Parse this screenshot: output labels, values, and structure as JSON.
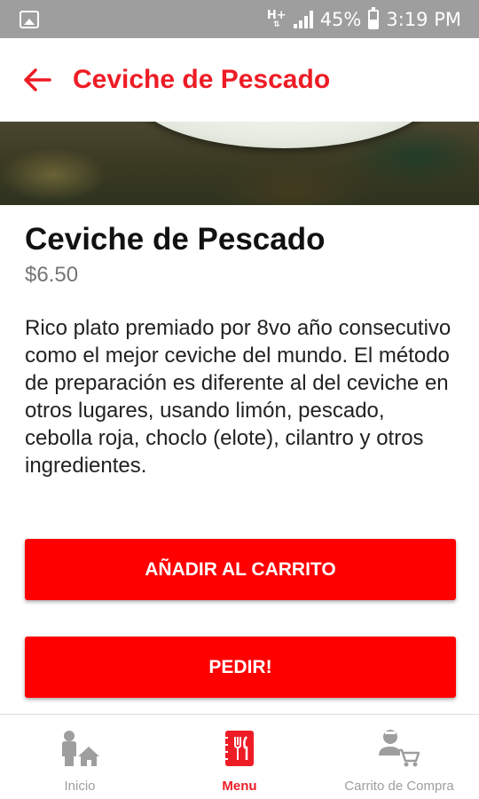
{
  "status_bar": {
    "network_type": "H+",
    "battery": "45%",
    "time": "3:19 PM"
  },
  "app_bar": {
    "title": "Ceviche de Pescado"
  },
  "product": {
    "name": "Ceviche de Pescado",
    "price": "$6.50",
    "description": "Rico plato premiado por 8vo año consecutivo como el mejor ceviche del mundo. El método de preparación es diferente al del ceviche en otros lugares, usando limón, pescado, cebolla roja, choclo (elote), cilantro y otros ingredientes."
  },
  "actions": {
    "add_to_cart": "AÑADIR AL CARRITO",
    "order": "PEDIR!"
  },
  "bottom_nav": {
    "items": [
      {
        "label": "Inicio",
        "icon": "home-person-icon",
        "active": false
      },
      {
        "label": "Menu",
        "icon": "menu-utensils-icon",
        "active": true
      },
      {
        "label": "Carrito de Compra",
        "icon": "person-cart-icon",
        "active": false
      }
    ]
  },
  "colors": {
    "accent": "#ee1c25",
    "button": "#ff0000",
    "status_bar": "#9e9e9e",
    "inactive": "#9e9e9e"
  }
}
